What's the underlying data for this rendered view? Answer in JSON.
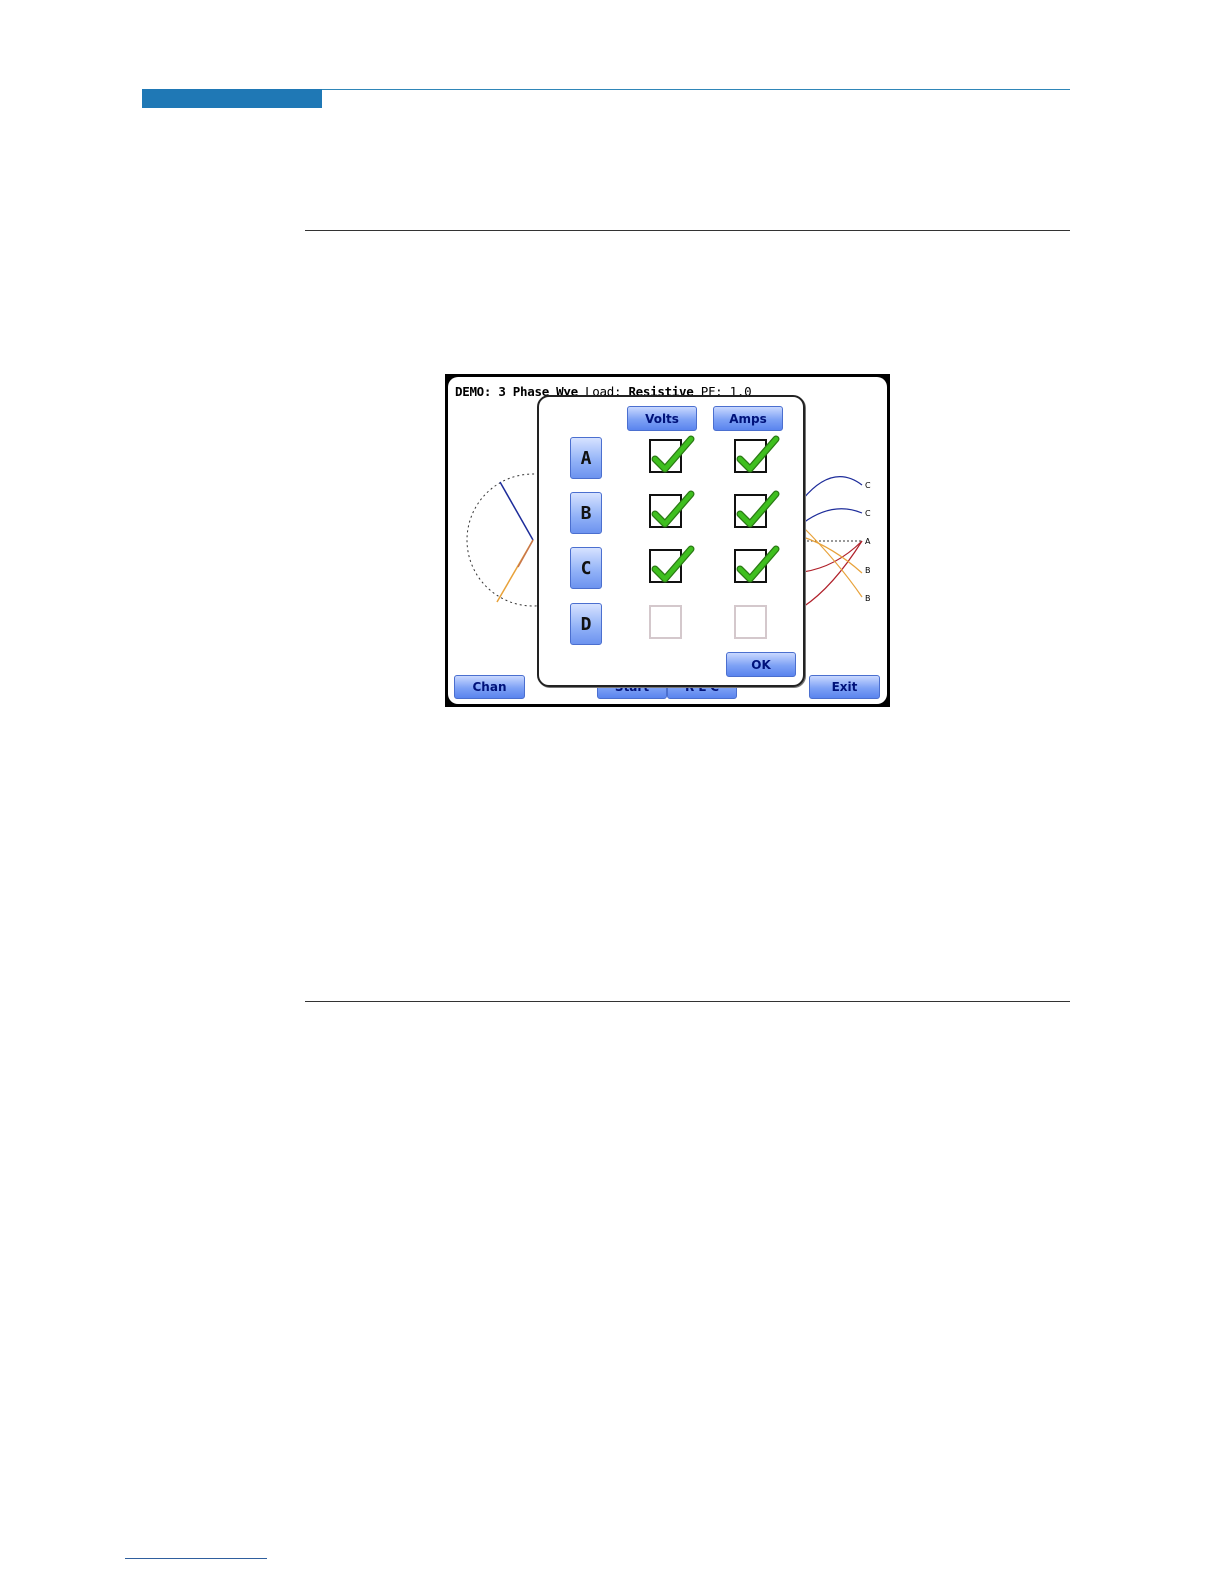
{
  "screen": {
    "title_demo": "DEMO: 3 Phase Wye",
    "title_load_label": "Load:",
    "title_load_value": "Resistive",
    "title_pf": "PF: 1.0",
    "phasor_labels": [
      "C",
      "C",
      "A",
      "B",
      "B"
    ],
    "buttons": {
      "chan": "Chan",
      "start": "Start",
      "rlc": "R L C",
      "exit": "Exit"
    }
  },
  "dialog": {
    "columns": [
      "Volts",
      "Amps"
    ],
    "rows": [
      {
        "label": "A",
        "volts": true,
        "amps": true
      },
      {
        "label": "B",
        "volts": true,
        "amps": true
      },
      {
        "label": "C",
        "volts": true,
        "amps": true
      },
      {
        "label": "D",
        "volts": false,
        "amps": false
      }
    ],
    "ok_label": "OK"
  },
  "colors": {
    "accent_blue": "#1f78b5",
    "button_blue": "#7da1f5",
    "check_green": "#3fbf1f",
    "phase_a": "#b0202a",
    "phase_b": "#e8a23a",
    "phase_c": "#1d2c9a"
  }
}
